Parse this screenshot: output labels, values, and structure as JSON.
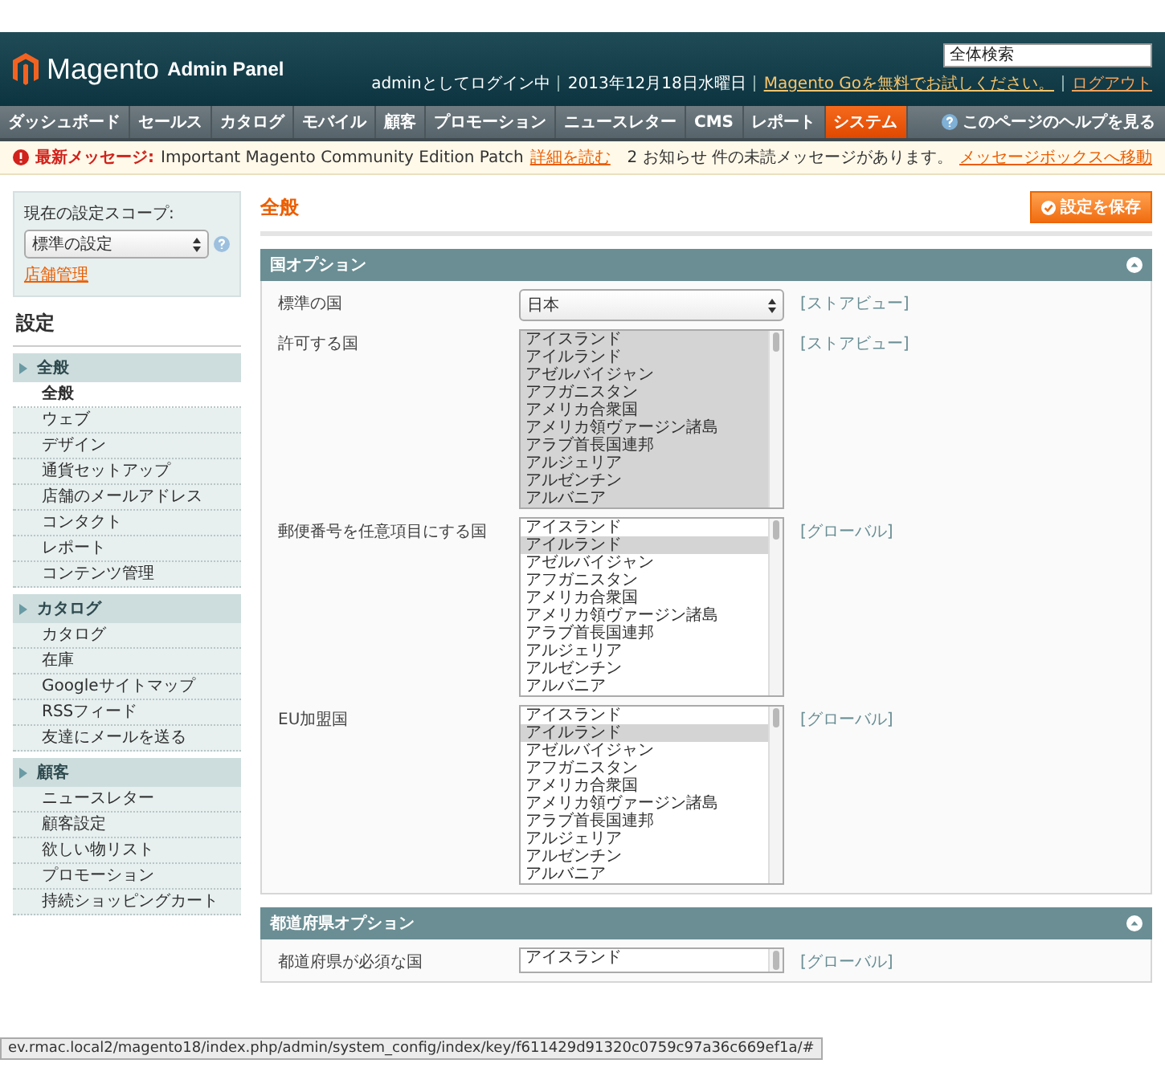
{
  "header": {
    "logo_text": "Magento",
    "logo_sub": "Admin Panel",
    "search": {
      "placeholder": "全体検索"
    },
    "user_info": "adminとしてログイン中",
    "date": "2013年12月18日水曜日",
    "promo_link": "Magento Goを無料でお試しください。",
    "logout": "ログアウト"
  },
  "nav": {
    "items": [
      {
        "label": "ダッシュボード",
        "selected": false
      },
      {
        "label": "セールス",
        "selected": false
      },
      {
        "label": "カタログ",
        "selected": false
      },
      {
        "label": "モバイル",
        "selected": false
      },
      {
        "label": "顧客",
        "selected": false
      },
      {
        "label": "プロモーション",
        "selected": false
      },
      {
        "label": "ニュースレター",
        "selected": false
      },
      {
        "label": "CMS",
        "selected": false
      },
      {
        "label": "レポート",
        "selected": false
      },
      {
        "label": "システム",
        "selected": true
      }
    ],
    "help": "このページのヘルプを見る"
  },
  "message": {
    "label": "最新メッセージ:",
    "text": "Important Magento Community Edition Patch",
    "link": "詳細を読む",
    "notice": "2 お知らせ 件の未読メッセージがあります。",
    "notice_link": "メッセージボックスへ移動"
  },
  "sidebar": {
    "scope_label": "現在の設定スコープ:",
    "scope_value": "標準の設定",
    "store_link": "店舗管理",
    "title": "設定",
    "groups": [
      {
        "title": "全般",
        "items": [
          {
            "label": "全般",
            "selected": true
          },
          {
            "label": "ウェブ",
            "selected": false
          },
          {
            "label": "デザイン",
            "selected": false
          },
          {
            "label": "通貨セットアップ",
            "selected": false
          },
          {
            "label": "店舗のメールアドレス",
            "selected": false
          },
          {
            "label": "コンタクト",
            "selected": false
          },
          {
            "label": "レポート",
            "selected": false
          },
          {
            "label": "コンテンツ管理",
            "selected": false
          }
        ]
      },
      {
        "title": "カタログ",
        "items": [
          {
            "label": "カタログ",
            "selected": false
          },
          {
            "label": "在庫",
            "selected": false
          },
          {
            "label": "Googleサイトマップ",
            "selected": false
          },
          {
            "label": "RSSフィード",
            "selected": false
          },
          {
            "label": "友達にメールを送る",
            "selected": false
          }
        ]
      },
      {
        "title": "顧客",
        "items": [
          {
            "label": "ニュースレター",
            "selected": false
          },
          {
            "label": "顧客設定",
            "selected": false
          },
          {
            "label": "欲しい物リスト",
            "selected": false
          },
          {
            "label": "プロモーション",
            "selected": false
          },
          {
            "label": "持続ショッピングカート",
            "selected": false
          }
        ]
      }
    ]
  },
  "main": {
    "title": "全般",
    "save_button": "設定を保存",
    "sections": [
      {
        "title": "国オプション",
        "rows": [
          {
            "label": "標準の国",
            "kind": "select",
            "value": "日本",
            "scope": "[ストアビュー]"
          },
          {
            "label": "許可する国",
            "kind": "multiselect",
            "scope": "[ストアビュー]",
            "options": [
              {
                "label": "アイスランド",
                "selected": true
              },
              {
                "label": "アイルランド",
                "selected": true
              },
              {
                "label": "アゼルバイジャン",
                "selected": true
              },
              {
                "label": "アフガニスタン",
                "selected": true
              },
              {
                "label": "アメリカ合衆国",
                "selected": true
              },
              {
                "label": "アメリカ領ヴァージン諸島",
                "selected": true
              },
              {
                "label": "アラブ首長国連邦",
                "selected": true
              },
              {
                "label": "アルジェリア",
                "selected": true
              },
              {
                "label": "アルゼンチン",
                "selected": true
              },
              {
                "label": "アルバニア",
                "selected": true
              }
            ]
          },
          {
            "label": "郵便番号を任意項目にする国",
            "kind": "multiselect",
            "scope": "[グローバル]",
            "options": [
              {
                "label": "アイスランド",
                "selected": false
              },
              {
                "label": "アイルランド",
                "selected": true
              },
              {
                "label": "アゼルバイジャン",
                "selected": false
              },
              {
                "label": "アフガニスタン",
                "selected": false
              },
              {
                "label": "アメリカ合衆国",
                "selected": false
              },
              {
                "label": "アメリカ領ヴァージン諸島",
                "selected": false
              },
              {
                "label": "アラブ首長国連邦",
                "selected": false
              },
              {
                "label": "アルジェリア",
                "selected": false
              },
              {
                "label": "アルゼンチン",
                "selected": false
              },
              {
                "label": "アルバニア",
                "selected": false
              }
            ]
          },
          {
            "label": "EU加盟国",
            "kind": "multiselect",
            "scope": "[グローバル]",
            "options": [
              {
                "label": "アイスランド",
                "selected": false
              },
              {
                "label": "アイルランド",
                "selected": true
              },
              {
                "label": "アゼルバイジャン",
                "selected": false
              },
              {
                "label": "アフガニスタン",
                "selected": false
              },
              {
                "label": "アメリカ合衆国",
                "selected": false
              },
              {
                "label": "アメリカ領ヴァージン諸島",
                "selected": false
              },
              {
                "label": "アラブ首長国連邦",
                "selected": false
              },
              {
                "label": "アルジェリア",
                "selected": false
              },
              {
                "label": "アルゼンチン",
                "selected": false
              },
              {
                "label": "アルバニア",
                "selected": false
              }
            ]
          }
        ]
      },
      {
        "title": "都道府県オプション",
        "rows": [
          {
            "label": "都道府県が必須な国",
            "kind": "multiselect",
            "scope": "[グローバル]",
            "options": [
              {
                "label": "アイスランド",
                "selected": false
              }
            ]
          }
        ]
      }
    ]
  },
  "status_url": "ev.rmac.local2/magento18/index.php/admin/system_config/index/key/f611429d91320c0759c97a36c669ef1a/#"
}
